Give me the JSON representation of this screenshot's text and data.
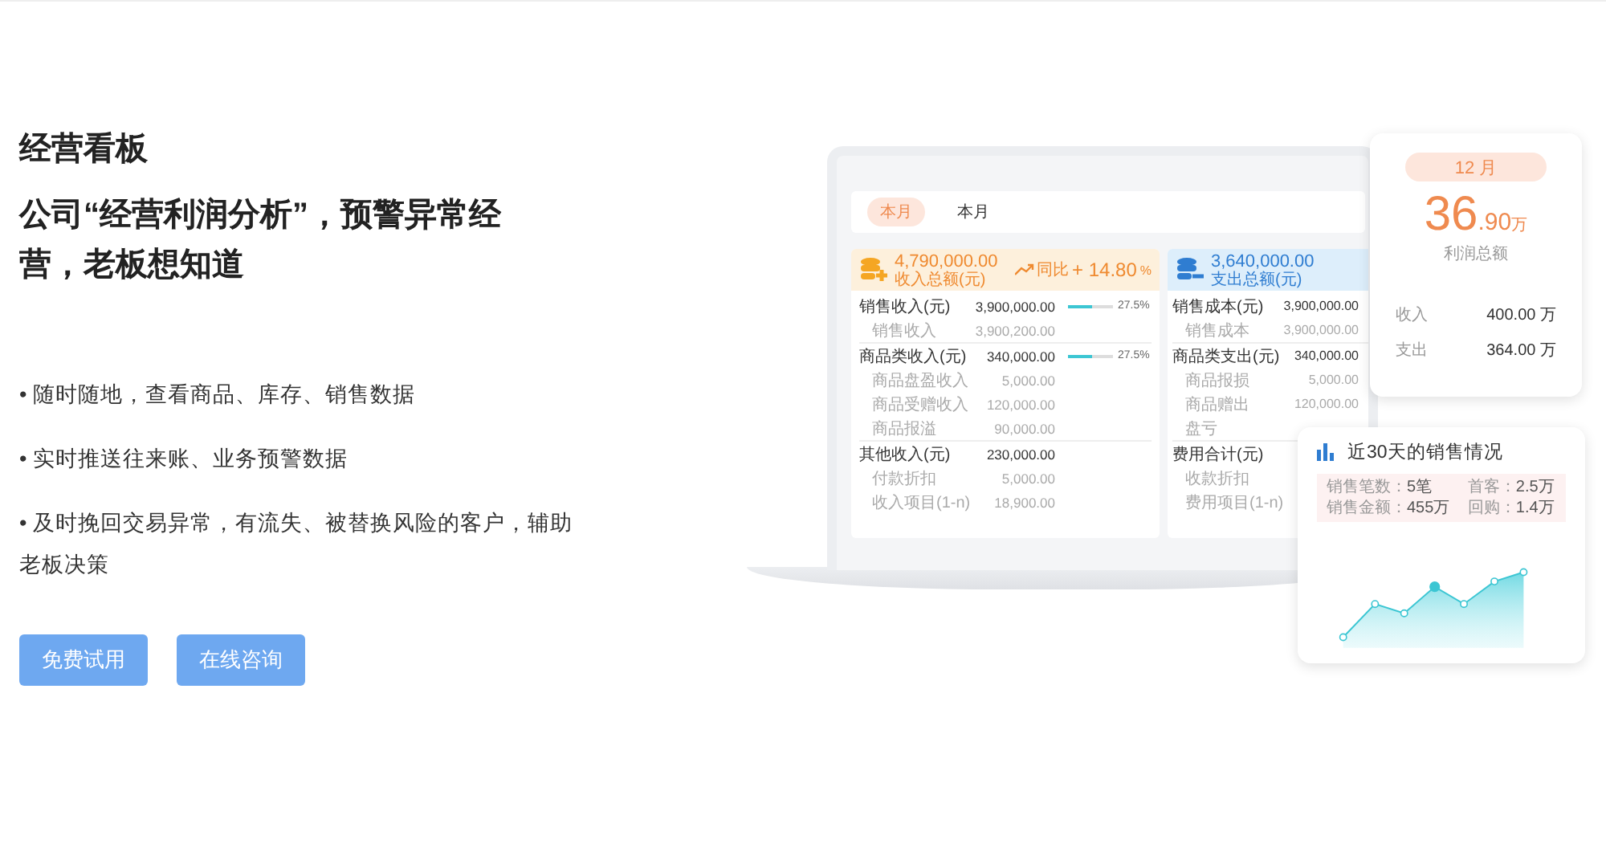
{
  "hero": {
    "section_title": "经营看板",
    "headline": "公司“经营利润分析”，预警异常经营，老板想知道",
    "bullets": [
      "• 随时随地，查看商品、库存、销售数据",
      "• 实时推送往来账、业务预警数据",
      "• 及时挽回交易异常，有流失、被替换风险的客户，辅助老板决策"
    ],
    "buttons": [
      "免费试用",
      "在线咨询"
    ]
  },
  "mockup": {
    "tabs": [
      {
        "label": "本月",
        "selected": true
      },
      {
        "label": "本月",
        "selected": false
      }
    ],
    "cards": [
      {
        "kind": "income",
        "total": "4,790,000.00",
        "total_label": "收入总额(元)",
        "change_label": "同比",
        "change": "+ 14.80",
        "change_unit": "%",
        "rows": [
          {
            "kind": "group",
            "label": "销售收入(元)",
            "value": "3,900,000.00",
            "level": 0.55,
            "reading": "27.5%"
          },
          {
            "kind": "item",
            "label": "销售收入",
            "value": "3,900,200.00"
          },
          {
            "kind": "group",
            "label": "商品类收入(元)",
            "value": "340,000.00",
            "level": 0.55,
            "reading": "27.5%"
          },
          {
            "kind": "item",
            "label": "商品盘盈收入",
            "value": "5,000.00"
          },
          {
            "kind": "item",
            "label": "商品受赠收入",
            "value": "120,000.00"
          },
          {
            "kind": "item",
            "label": "商品报溢",
            "value": "90,000.00"
          },
          {
            "kind": "group",
            "label": "其他收入(元)",
            "value": "230,000.00"
          },
          {
            "kind": "item",
            "label": "付款折扣",
            "value": "5,000.00"
          },
          {
            "kind": "item",
            "label": "收入项目(1-n)",
            "value": "18,900.00"
          }
        ]
      },
      {
        "kind": "expense",
        "total": "3,640,000.00",
        "total_label": "支出总额(元)",
        "rows": [
          {
            "kind": "group",
            "label": "销售成本(元)",
            "value": "3,900,000.00"
          },
          {
            "kind": "item",
            "label": "销售成本",
            "value": "3,900,000.00"
          },
          {
            "kind": "group",
            "label": "商品类支出(元)",
            "value": "340,000.00"
          },
          {
            "kind": "item",
            "label": "商品报损",
            "value": "5,000.00"
          },
          {
            "kind": "item",
            "label": "商品赠出",
            "value": "120,000.00"
          },
          {
            "kind": "item",
            "label": "盘亏"
          },
          {
            "kind": "group",
            "label": "费用合计(元)"
          },
          {
            "kind": "item",
            "label": "收款折扣"
          },
          {
            "kind": "item",
            "label": "费用项目(1-n)"
          }
        ]
      }
    ]
  },
  "profit_card": {
    "month": "12 月",
    "amount": "36",
    "decimals": ".90",
    "unit": "万",
    "caption": "利润总额",
    "rows": [
      {
        "label": "收入",
        "value": "400.00 万"
      },
      {
        "label": "支出",
        "value": "364.00 万"
      }
    ]
  },
  "sales_card": {
    "title": "近30天的销售情况",
    "stats": [
      {
        "label": "销售笔数：",
        "value": "5笔"
      },
      {
        "label": "首客：",
        "value": "2.5万"
      },
      {
        "label": "销售金额：",
        "value": "455万"
      },
      {
        "label": "回购：",
        "value": "1.4万"
      }
    ]
  }
}
